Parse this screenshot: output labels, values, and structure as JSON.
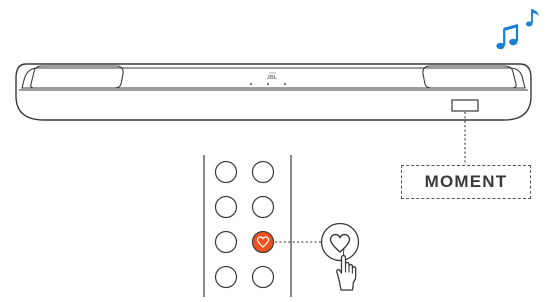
{
  "soundbar": {
    "brand_logo": "JBL"
  },
  "display": {
    "text": "MOMENT"
  },
  "icons": {
    "notes": "music-notes-icon",
    "heart": "heart-icon",
    "hand": "hand-pointer-icon"
  },
  "colors": {
    "note_blue": "#1a7fd0",
    "moment_button": "#f0531e",
    "outline": "#3a3a3a"
  }
}
